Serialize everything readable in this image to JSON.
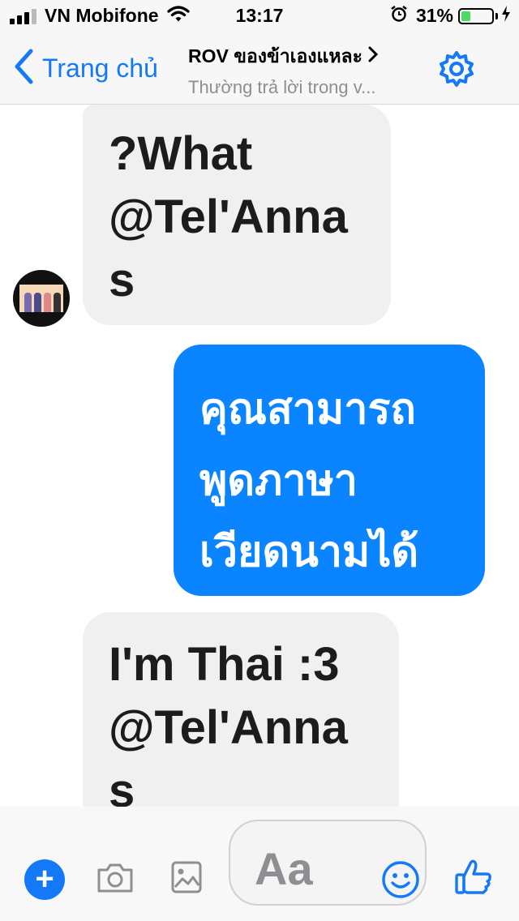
{
  "status_bar": {
    "carrier": "VN Mobifone",
    "time": "13:17",
    "battery_percent": "31%",
    "battery_level": 0.31,
    "icons": [
      "signal-icon",
      "wifi-icon",
      "alarm-icon",
      "battery-icon",
      "charging-icon"
    ]
  },
  "nav": {
    "back_label": "Trang chủ",
    "title": "ROV ของข้าเองแหละ",
    "subtitle": "Thường trả lời trong v...",
    "accent_color": "#1479f7"
  },
  "messages": [
    {
      "direction": "incoming",
      "lines": [
        "?What",
        "@Tel'Anna",
        "s"
      ]
    },
    {
      "direction": "outgoing",
      "lines": [
        "คุณสามารถ",
        "พูดภาษา",
        "เวียดนามได้"
      ]
    },
    {
      "direction": "incoming",
      "lines": [
        "I'm Thai  :3",
        "@Tel'Anna",
        "s"
      ]
    }
  ],
  "composer": {
    "placeholder": "Aa"
  },
  "colors": {
    "outgoing_bubble": "#0a84ff",
    "incoming_bubble": "#f1f0f0"
  }
}
